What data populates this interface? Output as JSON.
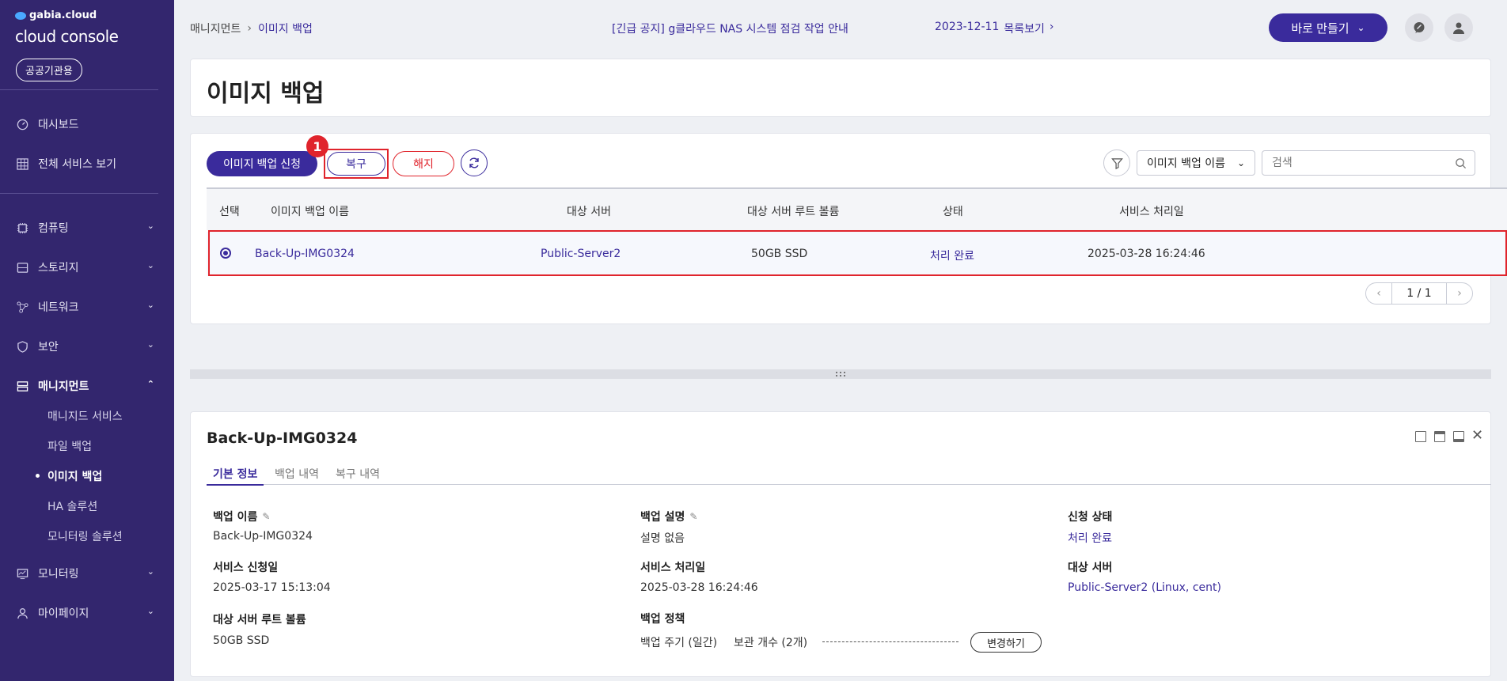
{
  "brand": {
    "top": "gabia.cloud",
    "main": "cloud console",
    "badge": "공공기관용"
  },
  "sidebar": {
    "items": [
      {
        "label": "대시보드",
        "icon": "dashboard-icon"
      },
      {
        "label": "전체 서비스 보기",
        "icon": "grid-icon"
      },
      {
        "label": "컴퓨팅",
        "icon": "chip-icon"
      },
      {
        "label": "스토리지",
        "icon": "storage-icon"
      },
      {
        "label": "네트워크",
        "icon": "network-icon"
      },
      {
        "label": "보안",
        "icon": "shield-icon"
      },
      {
        "label": "매니지먼트",
        "icon": "server-icon"
      },
      {
        "label": "모니터링",
        "icon": "monitor-icon"
      },
      {
        "label": "마이페이지",
        "icon": "user-icon"
      }
    ],
    "sub_items": [
      "매니지드 서비스",
      "파일 백업",
      "이미지 백업",
      "HA 솔루션",
      "모니터링 솔루션"
    ]
  },
  "header": {
    "breadcrumb": [
      "매니지먼트",
      "이미지 백업"
    ],
    "notice": "[긴급 공지] g클라우드 NAS 시스템 점검 작업 안내",
    "notice_date": "2023-12-11",
    "notice_link": "목록보기",
    "quick_create": "바로 만들기"
  },
  "page": {
    "title": "이미지 백업"
  },
  "toolbar": {
    "apply_label": "이미지 백업 신청",
    "restore_label": "복구",
    "cancel_label": "해지",
    "step_badge": "1",
    "search_select": "이미지 백업 이름",
    "search_placeholder": "검색"
  },
  "table": {
    "columns": [
      "선택",
      "이미지 백업 이름",
      "대상 서버",
      "대상 서버 루트 볼륨",
      "상태",
      "서비스 처리일"
    ],
    "rows": [
      {
        "name": "Back-Up-IMG0324",
        "server": "Public-Server2",
        "volume": "50GB SSD",
        "status": "처리 완료",
        "processed": "2025-03-28 16:24:46"
      }
    ],
    "pagination": "1 / 1"
  },
  "detail": {
    "title": "Back-Up-IMG0324",
    "tabs": [
      "기본 정보",
      "백업 내역",
      "복구 내역"
    ],
    "fields": {
      "backup_name_label": "백업 이름",
      "backup_name": "Back-Up-IMG0324",
      "backup_desc_label": "백업 설명",
      "backup_desc": "설명 없음",
      "apply_status_label": "신청 상태",
      "apply_status": "처리 완료",
      "service_applied_label": "서비스 신청일",
      "service_applied": "2025-03-17 15:13:04",
      "service_processed_label": "서비스 처리일",
      "service_processed": "2025-03-28 16:24:46",
      "target_server_label": "대상 서버",
      "target_server": "Public-Server2 (Linux, cent)",
      "root_volume_label": "대상 서버 루트 볼륨",
      "root_volume": "50GB SSD",
      "backup_policy_label": "백업 정책",
      "backup_cycle": "백업 주기 (일간)",
      "retention": "보관 개수 (2개)",
      "change_label": "변경하기"
    }
  },
  "colors": {
    "sidebar": "#33266e",
    "accent": "#3a2b9c",
    "danger": "#e0242c"
  }
}
